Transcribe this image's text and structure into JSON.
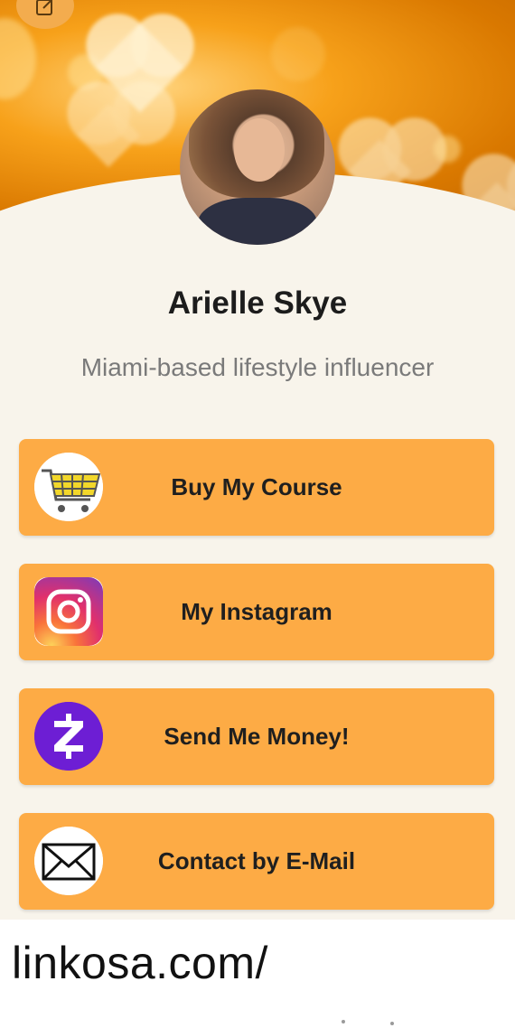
{
  "profile": {
    "name": "Arielle Skye",
    "bio": "Miami-based lifestyle influencer"
  },
  "links": [
    {
      "label": "Buy My Course",
      "icon": "shopping-cart-icon"
    },
    {
      "label": "My Instagram",
      "icon": "instagram-icon"
    },
    {
      "label": "Send Me Money!",
      "icon": "zelle-icon"
    },
    {
      "label": "Contact by E-Mail",
      "icon": "envelope-icon"
    }
  ],
  "footer": {
    "url": "linkosa.com/"
  },
  "colors": {
    "background": "#f8f4eb",
    "button": "#fdab45",
    "banner": "#f7a11a"
  }
}
